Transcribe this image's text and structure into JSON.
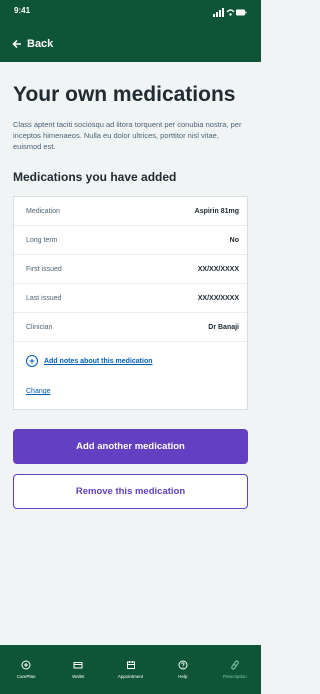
{
  "status_bar": {
    "time": "9:41"
  },
  "header": {
    "back_label": "Back"
  },
  "page": {
    "title": "Your own medications",
    "lead": "Class aptent taciti sociosqu ad litora torquent per conubia nostra, per inceptos himenaeos. Nulla eu dolor ultrices, porttitor nisl vitae, euismod est.",
    "section_heading": "Medications you have added"
  },
  "medication": {
    "rows": [
      {
        "label": "Medication",
        "value": "Aspirin 81mg"
      },
      {
        "label": "Long term",
        "value": "No"
      },
      {
        "label": "First issued",
        "value": "XX/XX/XXXX"
      },
      {
        "label": "Last issued",
        "value": "XX/XX/XXXX"
      },
      {
        "label": "Clinician",
        "value": "Dr Banaji"
      }
    ],
    "add_notes_label": "Add notes about this medication",
    "change_label": "Change"
  },
  "actions": {
    "add_label": "Add another medication",
    "remove_label": "Remove this medication"
  },
  "tabbar": {
    "items": [
      {
        "label": "CarePlan",
        "icon": "plus-circle-icon"
      },
      {
        "label": "Wallet",
        "icon": "wallet-icon"
      },
      {
        "label": "Appointment",
        "icon": "calendar-icon"
      },
      {
        "label": "Help",
        "icon": "question-icon"
      },
      {
        "label": "Prescription",
        "icon": "pill-icon"
      }
    ],
    "active_index": 4
  },
  "colors": {
    "brand_green": "#0e5437",
    "primary_purple": "#6340c1",
    "link_blue": "#005eb8"
  }
}
